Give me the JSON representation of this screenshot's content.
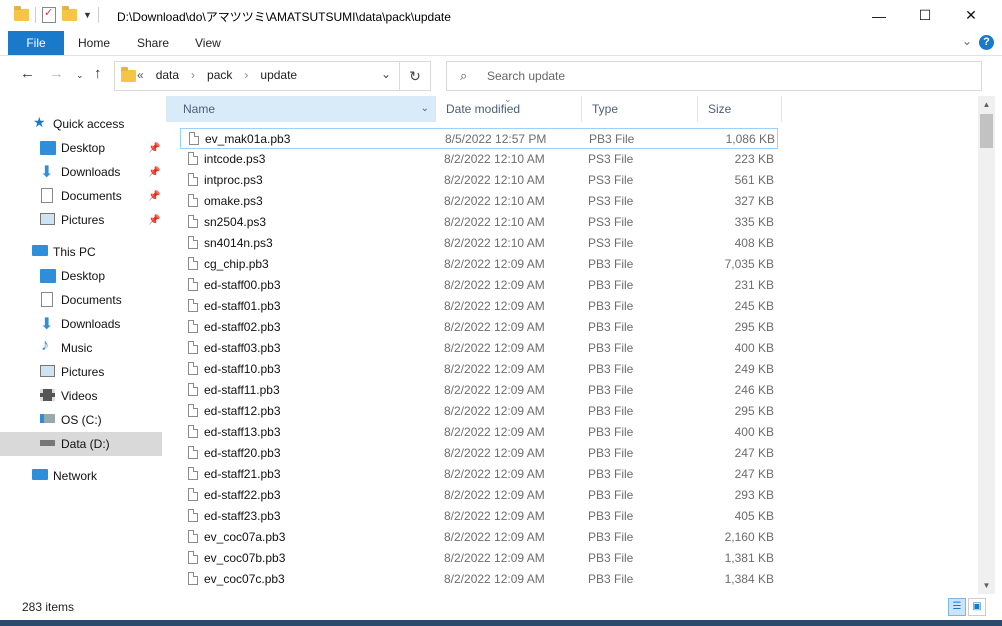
{
  "window": {
    "title": "D:\\Download\\do\\アマツツミ\\AMATSUTSUMI\\data\\pack\\update"
  },
  "window_controls": {
    "minimize": "—",
    "maximize": "☐",
    "close": "✕"
  },
  "ribbon": {
    "tabs": [
      "File",
      "Home",
      "Share",
      "View"
    ]
  },
  "address": {
    "overflow": "«",
    "crumbs": [
      "data",
      "pack",
      "update"
    ],
    "search_placeholder": "Search update"
  },
  "nav": {
    "quick_access": "Quick access",
    "quick_items": [
      "Desktop",
      "Downloads",
      "Documents",
      "Pictures"
    ],
    "this_pc": "This PC",
    "pc_items": [
      "Desktop",
      "Documents",
      "Downloads",
      "Music",
      "Pictures",
      "Videos",
      "OS (C:)",
      "Data (D:)"
    ],
    "network": "Network"
  },
  "columns": {
    "name": "Name",
    "date": "Date modified",
    "type": "Type",
    "size": "Size"
  },
  "files": [
    {
      "name": "ev_mak01a.pb3",
      "date": "8/5/2022 12:57 PM",
      "type": "PB3 File",
      "size": "1,086 KB"
    },
    {
      "name": "intcode.ps3",
      "date": "8/2/2022 12:10 AM",
      "type": "PS3 File",
      "size": "223 KB"
    },
    {
      "name": "intproc.ps3",
      "date": "8/2/2022 12:10 AM",
      "type": "PS3 File",
      "size": "561 KB"
    },
    {
      "name": "omake.ps3",
      "date": "8/2/2022 12:10 AM",
      "type": "PS3 File",
      "size": "327 KB"
    },
    {
      "name": "sn2504.ps3",
      "date": "8/2/2022 12:10 AM",
      "type": "PS3 File",
      "size": "335 KB"
    },
    {
      "name": "sn4014n.ps3",
      "date": "8/2/2022 12:10 AM",
      "type": "PS3 File",
      "size": "408 KB"
    },
    {
      "name": "cg_chip.pb3",
      "date": "8/2/2022 12:09 AM",
      "type": "PB3 File",
      "size": "7,035 KB"
    },
    {
      "name": "ed-staff00.pb3",
      "date": "8/2/2022 12:09 AM",
      "type": "PB3 File",
      "size": "231 KB"
    },
    {
      "name": "ed-staff01.pb3",
      "date": "8/2/2022 12:09 AM",
      "type": "PB3 File",
      "size": "245 KB"
    },
    {
      "name": "ed-staff02.pb3",
      "date": "8/2/2022 12:09 AM",
      "type": "PB3 File",
      "size": "295 KB"
    },
    {
      "name": "ed-staff03.pb3",
      "date": "8/2/2022 12:09 AM",
      "type": "PB3 File",
      "size": "400 KB"
    },
    {
      "name": "ed-staff10.pb3",
      "date": "8/2/2022 12:09 AM",
      "type": "PB3 File",
      "size": "249 KB"
    },
    {
      "name": "ed-staff11.pb3",
      "date": "8/2/2022 12:09 AM",
      "type": "PB3 File",
      "size": "246 KB"
    },
    {
      "name": "ed-staff12.pb3",
      "date": "8/2/2022 12:09 AM",
      "type": "PB3 File",
      "size": "295 KB"
    },
    {
      "name": "ed-staff13.pb3",
      "date": "8/2/2022 12:09 AM",
      "type": "PB3 File",
      "size": "400 KB"
    },
    {
      "name": "ed-staff20.pb3",
      "date": "8/2/2022 12:09 AM",
      "type": "PB3 File",
      "size": "247 KB"
    },
    {
      "name": "ed-staff21.pb3",
      "date": "8/2/2022 12:09 AM",
      "type": "PB3 File",
      "size": "247 KB"
    },
    {
      "name": "ed-staff22.pb3",
      "date": "8/2/2022 12:09 AM",
      "type": "PB3 File",
      "size": "293 KB"
    },
    {
      "name": "ed-staff23.pb3",
      "date": "8/2/2022 12:09 AM",
      "type": "PB3 File",
      "size": "405 KB"
    },
    {
      "name": "ev_coc07a.pb3",
      "date": "8/2/2022 12:09 AM",
      "type": "PB3 File",
      "size": "2,160 KB"
    },
    {
      "name": "ev_coc07b.pb3",
      "date": "8/2/2022 12:09 AM",
      "type": "PB3 File",
      "size": "1,381 KB"
    },
    {
      "name": "ev_coc07c.pb3",
      "date": "8/2/2022 12:09 AM",
      "type": "PB3 File",
      "size": "1,384 KB"
    }
  ],
  "status": {
    "count": "283 items"
  },
  "colors": {
    "accent": "#1979ca",
    "selection": "#cce8ff",
    "nav_selected": "#d9d9d9"
  }
}
